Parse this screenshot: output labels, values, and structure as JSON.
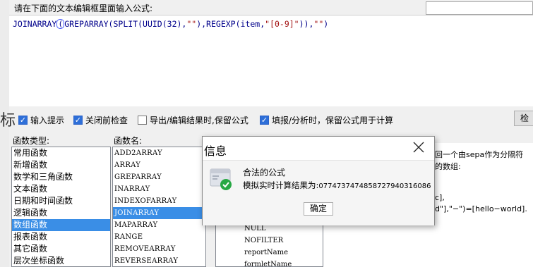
{
  "prompt_label": "请在下面的文本编辑框里面输入公式:",
  "formula": {
    "p1": "JOINARRAY",
    "cursor_char": "(",
    "p2": "GREPARRAY(SPLIT(UUID(32),",
    "s1": "\"\"",
    "p3": "),REGEXP(item,",
    "s2": "\"[0-9]\"",
    "p4": ")),",
    "s3": "\"\"",
    "p5": ")"
  },
  "left_glyph": "标",
  "options": [
    {
      "label": "输入提示",
      "checked": true
    },
    {
      "label": "关闭前检查",
      "checked": true
    },
    {
      "label": "导出/编辑结果时,保留公式",
      "checked": false
    },
    {
      "label": "填报/分析时，保留公式用于计算",
      "checked": true
    }
  ],
  "check_button": "检",
  "category_header": "函数类型:",
  "categories": [
    "常用函数",
    "新增函数",
    "数学和三角函数",
    "文本函数",
    "日期和时间函数",
    "逻辑函数",
    "数组函数",
    "报表函数",
    "其它函数",
    "层次坐标函数"
  ],
  "selected_category": "数组函数",
  "function_header": "函数名:",
  "functions": [
    "ADD2ARRAY",
    "ARRAY",
    "GREPARRAY",
    "INARRAY",
    "INDEXOFARRAY",
    "JOINARRAY",
    "MAPARRAY",
    "RANGE",
    "REMOVEARRAY",
    "REVERSEARRAY"
  ],
  "selected_function": "JOINARRAY",
  "variables_partial": [
    "NULL",
    "NOFILTER",
    "reportName",
    "formletName"
  ],
  "description_partial": {
    "line1": "回一个由sepa作为分隔符",
    "line2": "的数组:",
    "line3": "c],",
    "line4": "d\"],\"−\")=[hello−world]."
  },
  "dialog": {
    "title": "信息",
    "message": "合法的公式",
    "result_label": "模拟实时计算结果为:",
    "result_value": "0774737474858727940316086",
    "ok_label": "确定"
  },
  "colors": {
    "accent": "#3a8ee6",
    "formula": "#00008b",
    "string": "#a31515",
    "success": "#27a844"
  }
}
